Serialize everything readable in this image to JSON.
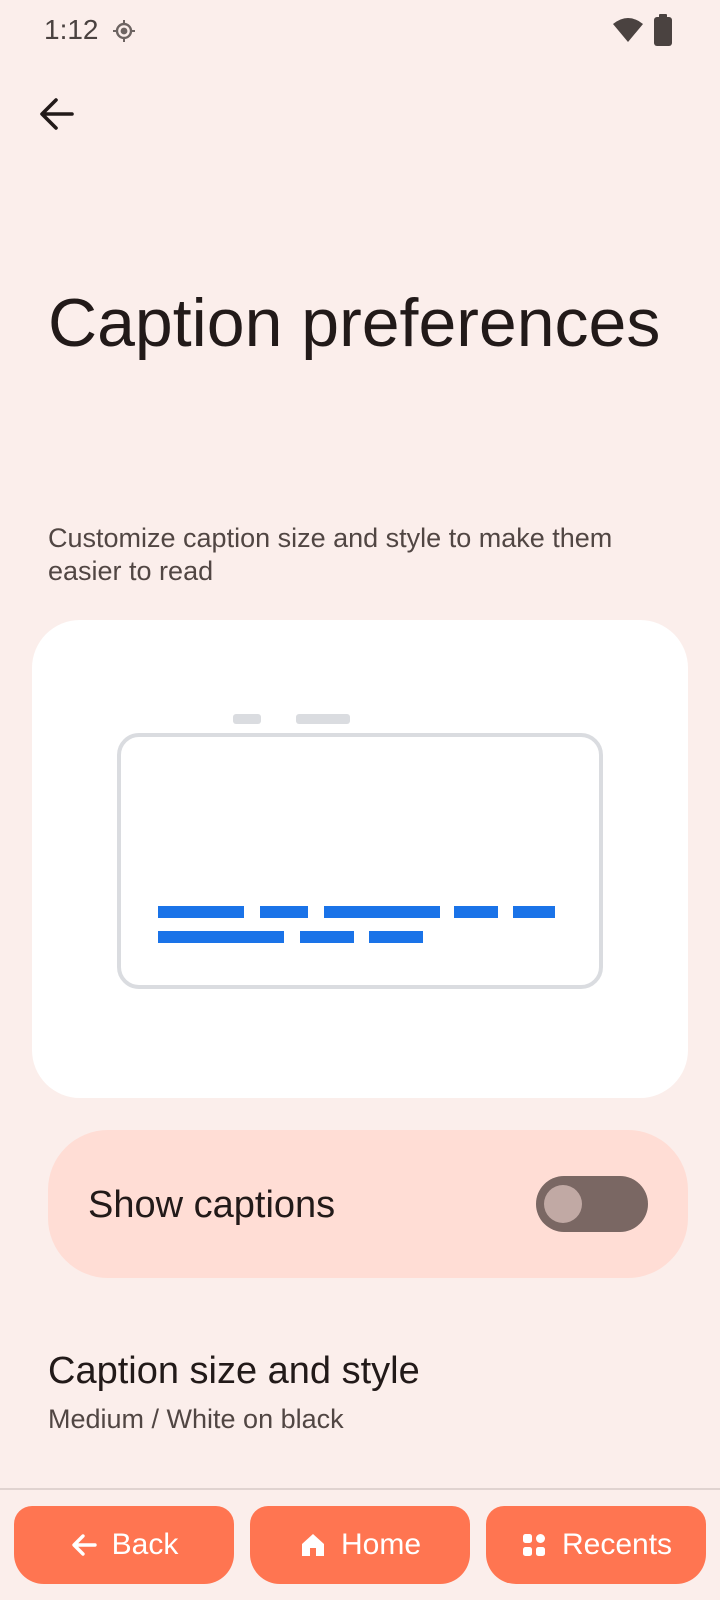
{
  "status_bar": {
    "time": "1:12"
  },
  "header": {
    "back_icon": "arrow-back-icon"
  },
  "page": {
    "title": "Caption preferences",
    "subtitle": "Customize caption size and style to make them easier to read"
  },
  "preview": {
    "caption_color": "#1a73e8"
  },
  "show_captions": {
    "label": "Show captions",
    "enabled": false
  },
  "caption_size_style": {
    "title": "Caption size and style",
    "summary": "Medium / White on black"
  },
  "nav": {
    "back_label": "Back",
    "home_label": "Home",
    "recents_label": "Recents"
  },
  "colors": {
    "background": "#fbeeeb",
    "accent": "#ff7551",
    "card": "#ffddd5"
  }
}
